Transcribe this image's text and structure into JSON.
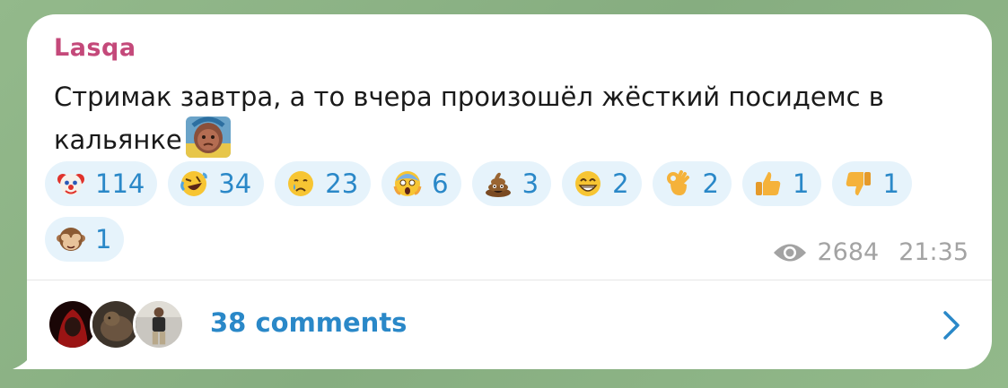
{
  "message": {
    "author": "Lasqa",
    "text": "Стримак завтра, а то вчера произошёл жёсткий посидемс в кальянке",
    "sticker": "custom-emoji-baby-sticker"
  },
  "reactions": [
    {
      "emoji": "clown-face",
      "count": "114"
    },
    {
      "emoji": "rolling-on-floor-laughing",
      "count": "34"
    },
    {
      "emoji": "crying-face",
      "count": "23"
    },
    {
      "emoji": "face-screaming-in-fear",
      "count": "6"
    },
    {
      "emoji": "pile-of-poo",
      "count": "3"
    },
    {
      "emoji": "beaming-face",
      "count": "2"
    },
    {
      "emoji": "ok-hand",
      "count": "2"
    },
    {
      "emoji": "thumbs-up",
      "count": "1"
    },
    {
      "emoji": "thumbs-down",
      "count": "1"
    },
    {
      "emoji": "see-no-evil-monkey",
      "count": "1"
    }
  ],
  "meta": {
    "views": "2684",
    "time": "21:35"
  },
  "comments": {
    "label": "38 comments"
  },
  "colors": {
    "author": "#c4497a",
    "accent": "#2a88c8",
    "reaction_bg": "#e6f3fb",
    "meta": "#a3a3a3"
  }
}
